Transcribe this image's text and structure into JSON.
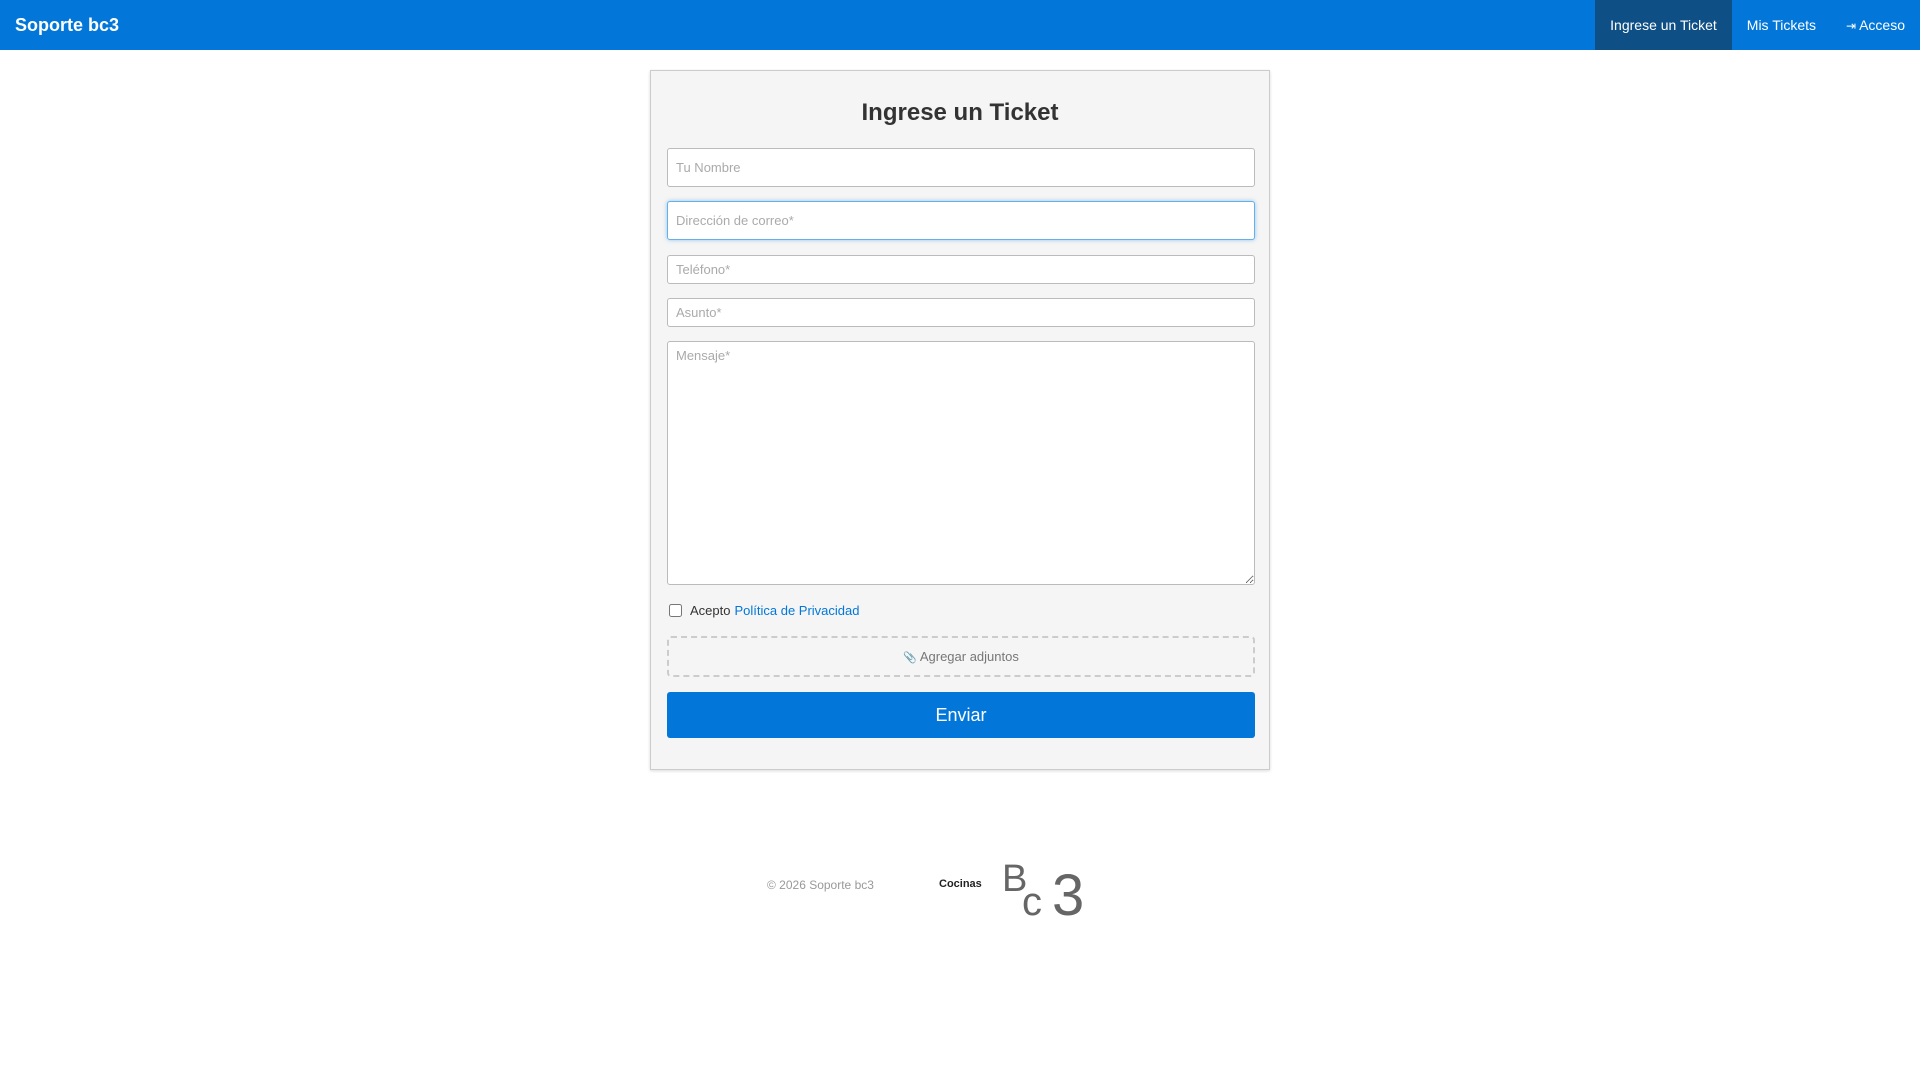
{
  "navbar": {
    "brand": "Soporte bc3",
    "items": [
      {
        "label": "Ingrese un Ticket",
        "active": true
      },
      {
        "label": "Mis Tickets",
        "active": false
      },
      {
        "label": "Acceso",
        "icon": "sign-in-icon",
        "active": false
      }
    ],
    "color": "#0277d9",
    "active_color": "#0e4f86"
  },
  "form": {
    "title": "Ingrese un Ticket",
    "name_placeholder": "Tu Nombre",
    "email_placeholder": "Dirección de correo*",
    "phone_placeholder": "Teléfono*",
    "subject_placeholder": "Asunto*",
    "message_placeholder": "Mensaje*",
    "privacy_prefix": "Acepto",
    "privacy_link": "Política de Privacidad",
    "privacy_checked": false,
    "attach_label": "Agregar adjuntos",
    "attach_icon": "paperclip-icon",
    "submit_label": "Enviar"
  },
  "footer": {
    "copyright": "© 2026 Soporte bc3",
    "logo_caption": "Cocinas",
    "logo_text": "Bc3"
  }
}
